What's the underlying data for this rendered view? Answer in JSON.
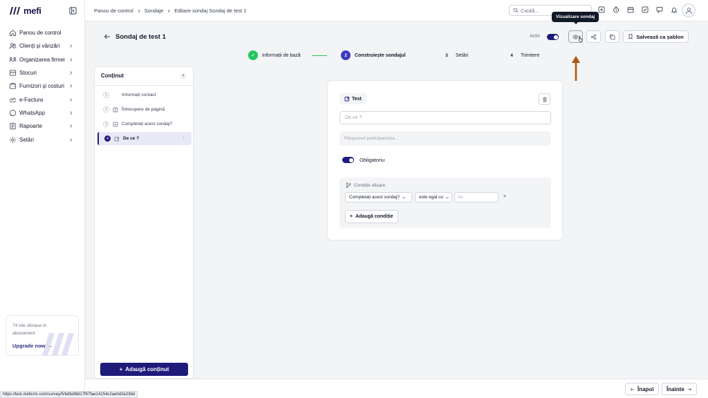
{
  "app": {
    "logo_text": "mefi"
  },
  "sidebar": {
    "items": [
      {
        "label": "Panou de control",
        "icon": "home-icon",
        "has_chevron": false
      },
      {
        "label": "Clienți și vânzări",
        "icon": "users-icon",
        "has_chevron": true
      },
      {
        "label": "Organizarea firmei",
        "icon": "org-icon",
        "has_chevron": true
      },
      {
        "label": "Stocuri",
        "icon": "box-icon",
        "has_chevron": true
      },
      {
        "label": "Furnizori și costuri",
        "icon": "wallet-icon",
        "has_chevron": true
      },
      {
        "label": "e-Factura",
        "icon": "efactura-icon",
        "has_chevron": true
      },
      {
        "label": "WhatsApp",
        "icon": "whatsapp-icon",
        "has_chevron": true
      },
      {
        "label": "Rapoarte",
        "icon": "report-icon",
        "has_chevron": true
      },
      {
        "label": "Setări",
        "icon": "gear-icon",
        "has_chevron": true
      }
    ],
    "upgrade": {
      "text": "74 zile rămase în abonament",
      "cta": "Upgrade now"
    }
  },
  "topbar": {
    "breadcrumb": [
      "Panou de control",
      "Sondaje",
      "Editare sondaj Sondaj de test 1"
    ],
    "search_placeholder": "Caută..."
  },
  "header": {
    "title": "Sondaj de test 1",
    "active_label": "Activ",
    "active": true,
    "tooltip": "Vizualizare sondaj",
    "save_template_label": "Salvează ca șablon"
  },
  "stepper": {
    "steps": [
      {
        "number": "✓",
        "label": "Informații de bază",
        "state": "done"
      },
      {
        "number": "2",
        "label": "Construiește sondajul",
        "state": "active"
      },
      {
        "number": "3",
        "label": "Setări",
        "state": "pending"
      },
      {
        "number": "4",
        "label": "Trimitere",
        "state": "pending"
      }
    ]
  },
  "content_panel": {
    "title": "Conținut",
    "count": "4",
    "items": [
      {
        "number": "1",
        "label": "Informații contact",
        "icon": ""
      },
      {
        "number": "2",
        "label": "Întrerupere de pagină",
        "icon": "page-break-icon"
      },
      {
        "number": "3",
        "label": "Completați acest sondaj?",
        "icon": "checkbox-icon"
      },
      {
        "number": "4",
        "label": "De ce ?",
        "icon": "edit-icon",
        "active": true
      }
    ],
    "add_button": "Adaugă conținut"
  },
  "editor": {
    "type_label": "Text",
    "question_placeholder": "De ce ?",
    "answer_placeholder": "Răspunsul participantului...",
    "required_label": "Obligatoriu",
    "required": true,
    "condition": {
      "title": "Condiție afișare",
      "field": "Completați acest sondaj?",
      "operator": "este egal cu",
      "value_placeholder": "nu",
      "remove": "×",
      "add_label": "Adaugă condiție"
    }
  },
  "footer": {
    "back_label": "Înapoi",
    "next_label": "Înainte"
  },
  "status_url": "https://test.meficrm.com/survey/5/bdfa98d17f67fae14154c2ae0d2e23bd",
  "colors": {
    "primary": "#1e1b7b",
    "success": "#22c55e",
    "annotation_arrow": "#b4520a"
  }
}
